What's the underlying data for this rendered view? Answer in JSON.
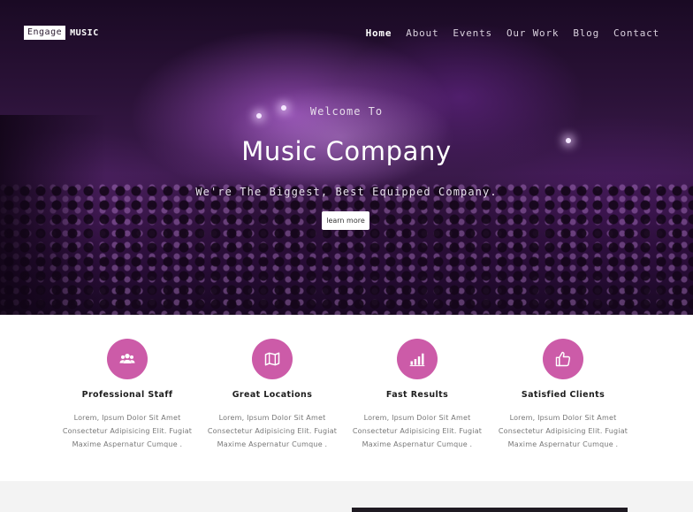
{
  "logo": {
    "box_text": "Engage",
    "word": "MUSIC"
  },
  "nav": {
    "items": [
      "Home",
      "About",
      "Events",
      "Our Work",
      "Blog",
      "Contact"
    ],
    "active": "Home"
  },
  "hero": {
    "welcome": "Welcome To",
    "headline": "Music Company",
    "tagline": "We're The Biggest, Best Equipped Company.",
    "button_label": "learn more"
  },
  "features": [
    {
      "icon": "people-icon",
      "title": "Professional Staff",
      "desc": [
        "Lorem, Ipsum Dolor Sit Amet",
        "Consectetur Adipisicing Elit. Fugiat",
        "Maxime Aspernatur Cumque ."
      ]
    },
    {
      "icon": "map-icon",
      "title": "Great Locations",
      "desc": [
        "Lorem, Ipsum Dolor Sit Amet",
        "Consectetur Adipisicing Elit. Fugiat",
        "Maxime Aspernatur Cumque ."
      ]
    },
    {
      "icon": "bar-chart-icon",
      "title": "Fast Results",
      "desc": [
        "Lorem, Ipsum Dolor Sit Amet",
        "Consectetur Adipisicing Elit. Fugiat",
        "Maxime Aspernatur Cumque ."
      ]
    },
    {
      "icon": "thumbs-up-icon",
      "title": "Satisfied Clients",
      "desc": [
        "Lorem, Ipsum Dolor Sit Amet",
        "Consectetur Adipisicing Elit. Fugiat",
        "Maxime Aspernatur Cumque ."
      ]
    }
  ],
  "colors": {
    "accent": "#cc5ba8",
    "hero_tint": "#3b1a4c",
    "text_dark": "#1d1d1d",
    "text_muted": "#777777"
  }
}
